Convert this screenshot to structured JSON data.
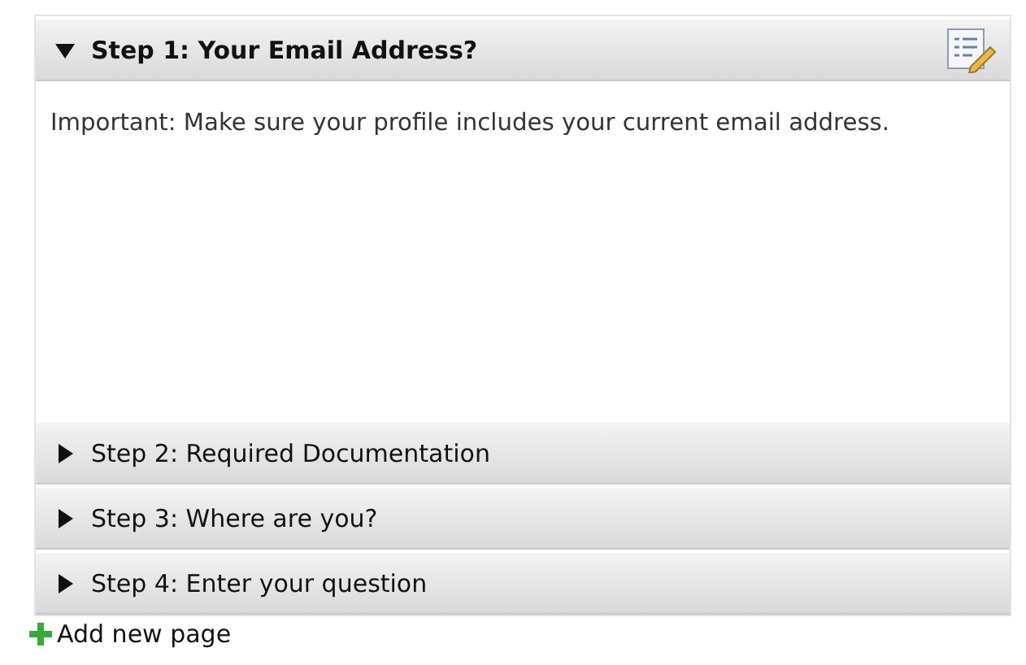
{
  "steps": [
    {
      "title": "Step 1: Your Email Address?",
      "expanded": true,
      "body": "Important: Make sure your profile includes your current email address."
    },
    {
      "title": "Step 2: Required Documentation",
      "expanded": false
    },
    {
      "title": "Step 3: Where are you?",
      "expanded": false
    },
    {
      "title": "Step 4: Enter your question",
      "expanded": false
    }
  ],
  "add_link": "Add new page"
}
